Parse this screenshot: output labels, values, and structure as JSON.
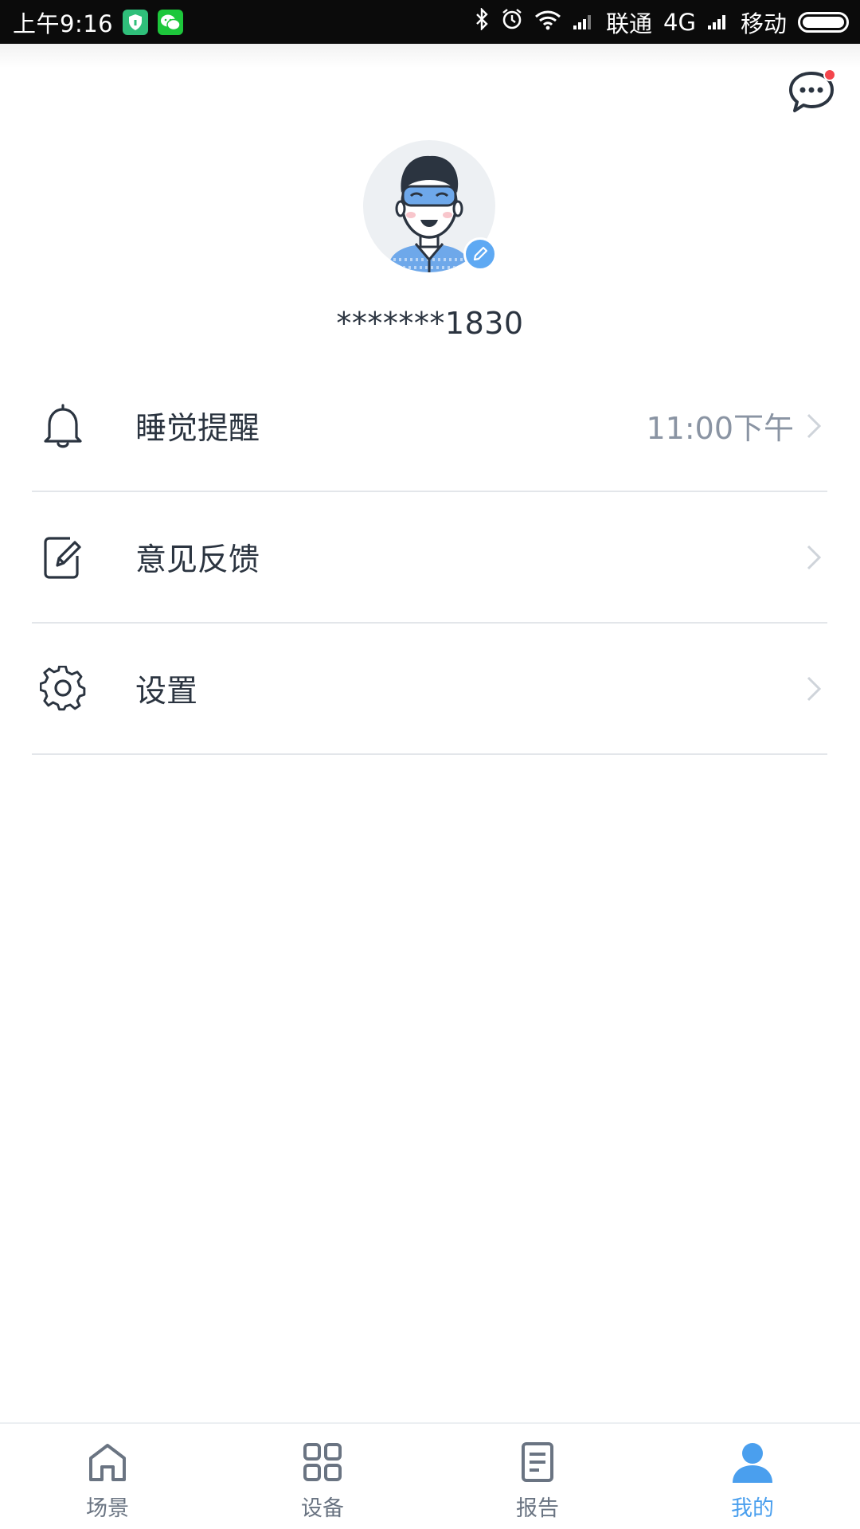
{
  "status_bar": {
    "time": "上午9:16",
    "carrier1": "联通",
    "network": "4G",
    "carrier2": "移动",
    "icons": [
      "shield-app-icon",
      "wechat-icon",
      "bluetooth-icon",
      "alarm-icon",
      "wifi-icon",
      "signal-icon",
      "battery-icon"
    ]
  },
  "header": {
    "message_icon": "chat-bubble-icon",
    "has_notification": true
  },
  "profile": {
    "username": "*******1830",
    "avatar": "user-avatar-illustration",
    "edit_icon": "pencil-icon"
  },
  "menu": {
    "items": [
      {
        "label": "睡觉提醒",
        "value": "11:00下午",
        "icon": "bell-icon"
      },
      {
        "label": "意见反馈",
        "value": "",
        "icon": "edit-note-icon"
      },
      {
        "label": "设置",
        "value": "",
        "icon": "gear-icon"
      }
    ]
  },
  "bottom_nav": {
    "items": [
      {
        "label": "场景",
        "icon": "home-icon",
        "active": false
      },
      {
        "label": "设备",
        "icon": "grid-icon",
        "active": false
      },
      {
        "label": "报告",
        "icon": "document-icon",
        "active": false
      },
      {
        "label": "我的",
        "icon": "person-icon",
        "active": true
      }
    ]
  },
  "colors": {
    "accent": "#4a9fee",
    "notification_dot": "#f4454c",
    "text_primary": "#2b3440",
    "text_secondary": "#8a94a3"
  }
}
